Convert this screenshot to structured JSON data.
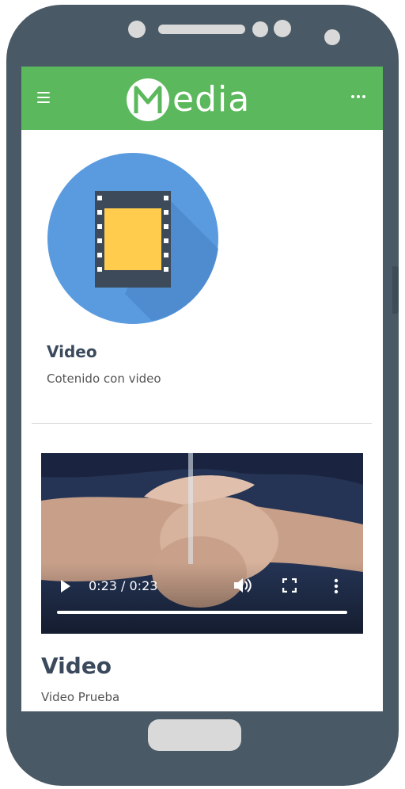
{
  "app": {
    "logo_initial": "M",
    "logo_text": "edia",
    "brand_color": "#5cb85c"
  },
  "header": {
    "menu_icon": "hamburger-menu-icon",
    "more_icon": "more-horizontal-icon"
  },
  "content_card": {
    "icon": "film-strip-icon",
    "title": "Video",
    "subtitle": "Cotenido con video"
  },
  "video_player": {
    "time": "0:23 / 0:23",
    "progress": 1.0,
    "controls": [
      "play-icon",
      "volume-icon",
      "fullscreen-icon",
      "more-vertical-icon"
    ]
  },
  "video_card": {
    "title": "Video",
    "subtitle": "Video Prueba"
  }
}
